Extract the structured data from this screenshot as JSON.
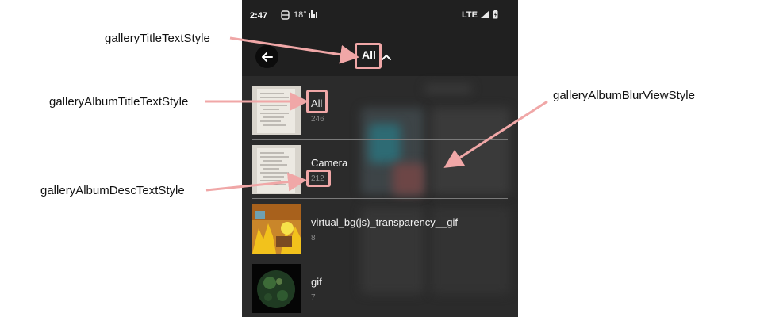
{
  "annotations": {
    "title_style": "galleryTitleTextStyle",
    "album_title_style": "galleryAlbumTitleTextStyle",
    "album_desc_style": "galleryAlbumDescTextStyle",
    "album_blur_style": "galleryAlbumBlurViewStyle"
  },
  "status_bar": {
    "time": "2:47",
    "temperature": "18°",
    "network": "LTE"
  },
  "toolbar": {
    "title": "All"
  },
  "albums": [
    {
      "title": "All",
      "count": "246"
    },
    {
      "title": "Camera",
      "count": "212"
    },
    {
      "title": "virtual_bg(js)_transparency__gif",
      "count": "8"
    },
    {
      "title": "gif",
      "count": "7"
    }
  ],
  "colors": {
    "annotation_pink": "#f0a7a7",
    "background_dark": "#262626"
  }
}
